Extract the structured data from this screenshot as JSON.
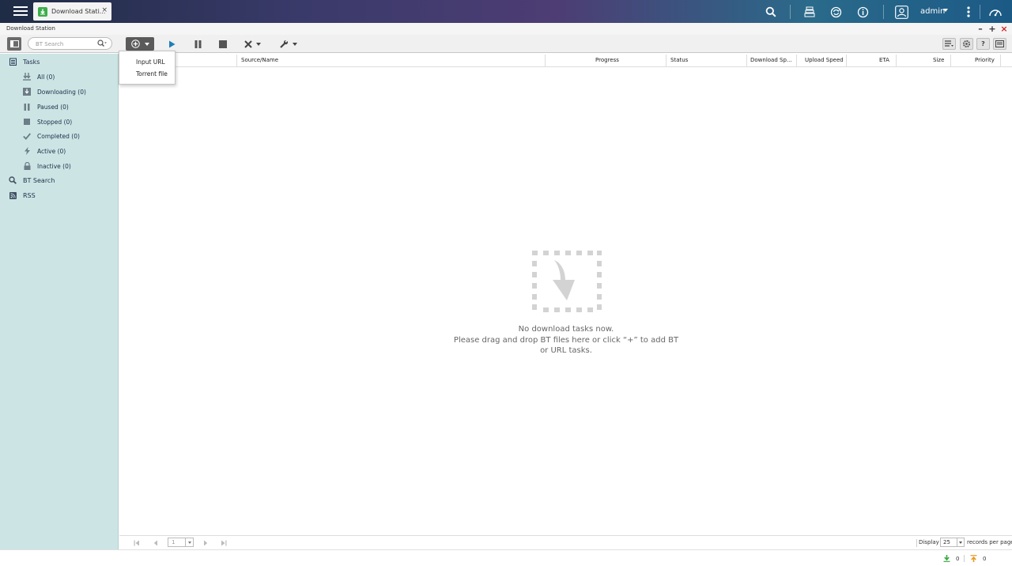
{
  "topbar": {
    "menu_icon": "hamburger-menu-icon",
    "tab": {
      "label": "Download Stati...",
      "icon": "download-station-icon",
      "close": "×"
    },
    "icons": [
      "search-icon",
      "stacked-layers-icon",
      "sync-icon",
      "info-icon",
      "user-icon",
      "more-vertical-icon",
      "dashboard-gauge-icon"
    ],
    "user": "admin"
  },
  "window": {
    "title": "Download Station",
    "minimize": "–",
    "maximize": "+",
    "close": "×"
  },
  "toolbar": {
    "search_placeholder": "BT Search",
    "buttons": [
      "sidebar-toggle-icon",
      "add-icon",
      "play-icon",
      "pause-icon",
      "stop-icon",
      "remove-icon",
      "wrench-icon"
    ],
    "right_buttons": [
      "list-settings-icon",
      "gear-icon",
      "help-icon",
      "panel-icon"
    ]
  },
  "add_menu": {
    "items": [
      "Input URL",
      "Torrent file"
    ]
  },
  "sidebar": {
    "tasks_label": "Tasks",
    "items": [
      {
        "label": "All (0)",
        "icon": "all-icon"
      },
      {
        "label": "Downloading (0)",
        "icon": "downloading-icon"
      },
      {
        "label": "Paused (0)",
        "icon": "paused-icon"
      },
      {
        "label": "Stopped (0)",
        "icon": "stopped-icon"
      },
      {
        "label": "Completed (0)",
        "icon": "check-icon"
      },
      {
        "label": "Active (0)",
        "icon": "bolt-icon"
      },
      {
        "label": "Inactive (0)",
        "icon": "lock-icon"
      }
    ],
    "bt_search_label": "BT Search",
    "rss_label": "RSS"
  },
  "grid": {
    "columns": [
      "Source/Name",
      "Progress",
      "Status",
      "Download Sp...",
      "Upload Speed",
      "ETA",
      "Size",
      "Priority"
    ]
  },
  "empty_state": {
    "line1": "No download tasks now.",
    "line2": "Please drag and drop BT files here or click “+” to add BT",
    "line3": "or URL tasks."
  },
  "pager": {
    "page": "1",
    "display_label": "Display",
    "per_page": "25",
    "records_label": "records per page."
  },
  "status": {
    "download_count": "0",
    "upload_count": "0",
    "download_color": "#3aa845",
    "upload_color": "#e89a1e"
  }
}
